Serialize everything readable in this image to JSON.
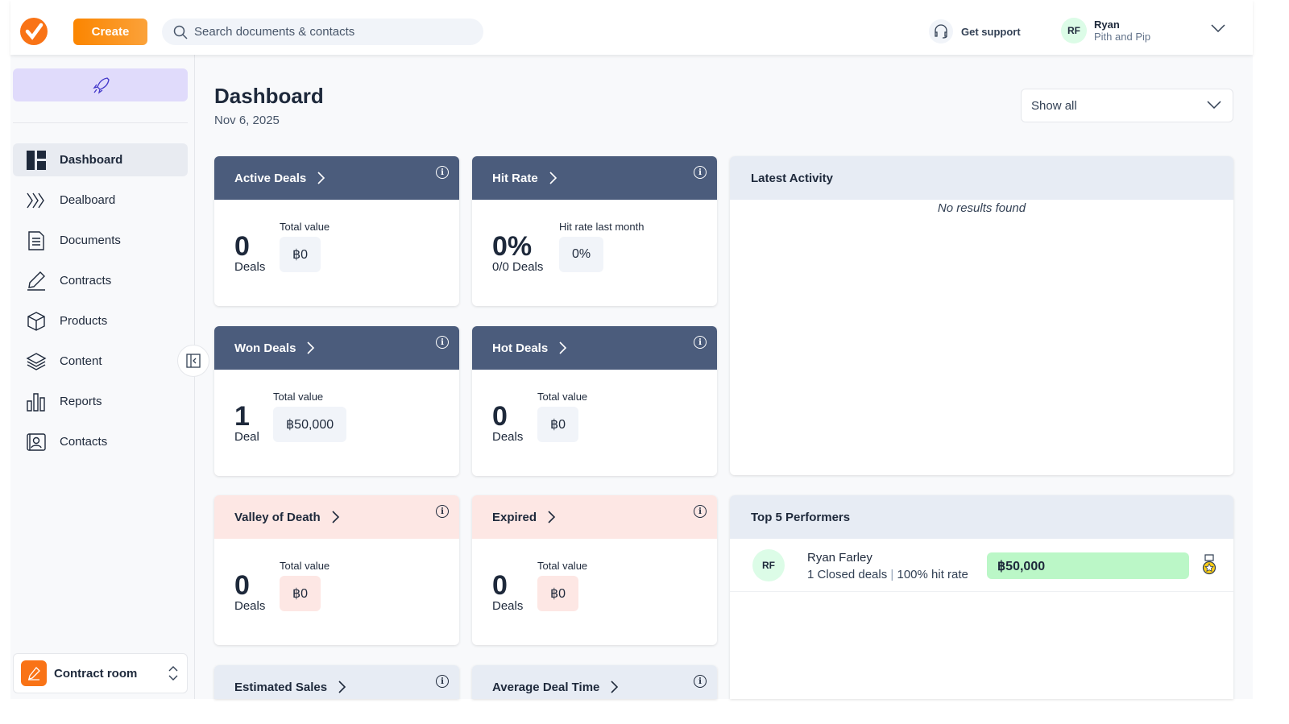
{
  "header": {
    "create_label": "Create",
    "search_placeholder": "Search documents & contacts",
    "support_label": "Get support",
    "user": {
      "initials": "RF",
      "name": "Ryan",
      "org": "Pith and Pip"
    }
  },
  "sidebar": {
    "items": [
      {
        "label": "Dashboard",
        "icon": "dashboard-icon"
      },
      {
        "label": "Dealboard",
        "icon": "dealboard-icon"
      },
      {
        "label": "Documents",
        "icon": "document-icon"
      },
      {
        "label": "Contracts",
        "icon": "pen-icon"
      },
      {
        "label": "Products",
        "icon": "box-icon"
      },
      {
        "label": "Content",
        "icon": "layers-icon"
      },
      {
        "label": "Reports",
        "icon": "bar-chart-icon"
      },
      {
        "label": "Contacts",
        "icon": "contact-card-icon"
      }
    ],
    "room_label": "Contract room"
  },
  "page": {
    "title": "Dashboard",
    "date": "Nov 6, 2025",
    "filter": "Show all"
  },
  "cards": [
    {
      "title": "Active Deals",
      "number": "0",
      "unit": "Deals",
      "label": "Total value",
      "value": "฿0"
    },
    {
      "title": "Hit Rate",
      "number": "0%",
      "unit": "0/0 Deals",
      "label": "Hit rate last month",
      "value": "0%"
    },
    {
      "title": "Won Deals",
      "number": "1",
      "unit": "Deal",
      "label": "Total value",
      "value": "฿50,000"
    },
    {
      "title": "Hot Deals",
      "number": "0",
      "unit": "Deals",
      "label": "Total value",
      "value": "฿0"
    },
    {
      "title": "Valley of Death",
      "number": "0",
      "unit": "Deals",
      "label": "Total value",
      "value": "฿0"
    },
    {
      "title": "Expired",
      "number": "0",
      "unit": "Deals",
      "label": "Total value",
      "value": "฿0"
    },
    {
      "title": "Estimated Sales"
    },
    {
      "title": "Average Deal Time"
    }
  ],
  "activity": {
    "title": "Latest Activity",
    "empty": "No results found"
  },
  "performers": {
    "title": "Top 5 Performers",
    "rows": [
      {
        "initials": "RF",
        "name": "Ryan Farley",
        "closed": "1 Closed deals",
        "hit_rate": "100% hit rate",
        "value": "฿50,000"
      }
    ]
  },
  "colors": {
    "accent": "#f97316",
    "card_header_dark": "#4b5c7c",
    "card_header_warning": "#fde7e4",
    "performer_bar": "#bbf7c7"
  }
}
